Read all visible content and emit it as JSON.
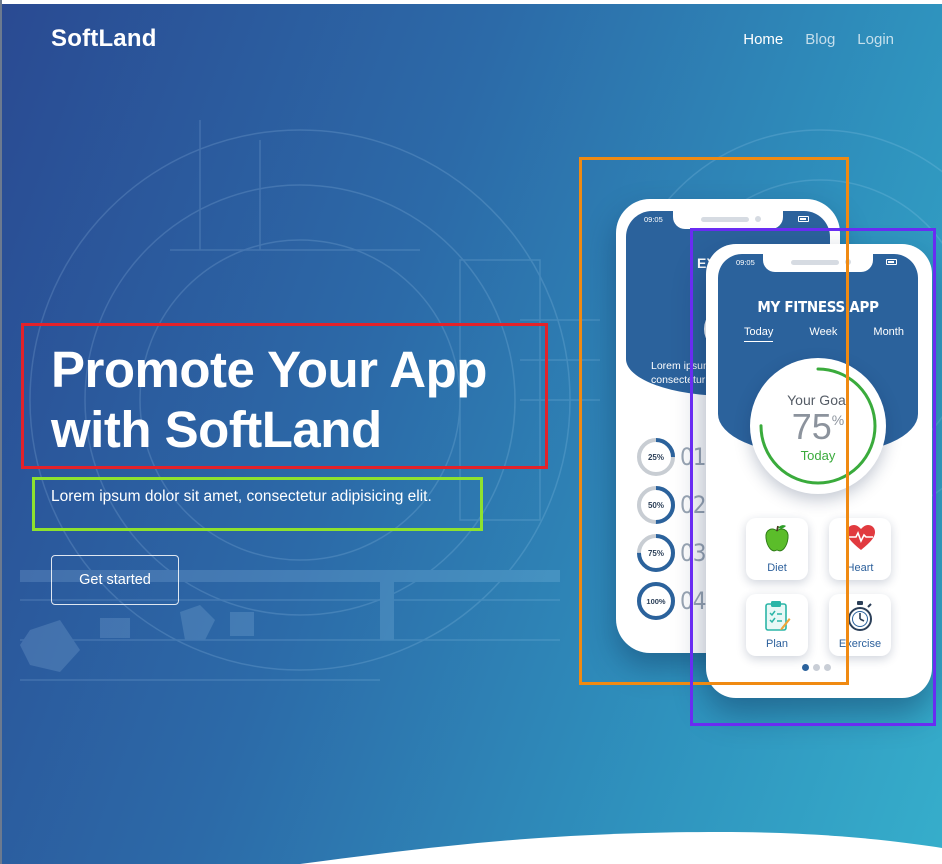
{
  "brand": "SoftLand",
  "nav": [
    {
      "label": "Home",
      "active": true
    },
    {
      "label": "Blog",
      "active": false
    },
    {
      "label": "Login",
      "active": false
    }
  ],
  "hero": {
    "headline_line1": "Promote Your App",
    "headline_line2": "with SoftLand",
    "subtitle": "Lorem ipsum dolor sit amet, consectetur adipisicing elit.",
    "cta_label": "Get started"
  },
  "phone_back": {
    "time": "09:05",
    "title": "EXE",
    "lorem_line1": "Lorem ipsum",
    "lorem_line2": "consectetur",
    "progress": [
      {
        "percent_label": "25%",
        "value": 25,
        "number": "01"
      },
      {
        "percent_label": "50%",
        "value": 50,
        "number": "02"
      },
      {
        "percent_label": "75%",
        "value": 75,
        "number": "03"
      },
      {
        "percent_label": "100%",
        "value": 100,
        "number": "04"
      }
    ]
  },
  "phone_front": {
    "time": "09:05",
    "title": "MY FITNESS APP",
    "tabs": [
      {
        "label": "Today",
        "active": true
      },
      {
        "label": "Week",
        "active": false
      },
      {
        "label": "Month",
        "active": false
      }
    ],
    "goal": {
      "label": "Your Goal",
      "value": "75",
      "unit": "%",
      "period": "Today",
      "fraction": 0.75
    },
    "tiles": [
      {
        "label": "Diet",
        "icon": "apple-icon"
      },
      {
        "label": "Heart",
        "icon": "heart-icon"
      },
      {
        "label": "Plan",
        "icon": "clipboard-icon"
      },
      {
        "label": "Exercise",
        "icon": "stopwatch-icon"
      }
    ],
    "carousel": {
      "total": 3,
      "active": 1
    }
  },
  "colors": {
    "gradient_start": "#2a4a92",
    "gradient_end": "#36aecb",
    "phone_header": "#2b629c",
    "goal_green": "#3aab3c",
    "annotation_red": "#e3222a",
    "annotation_green": "#8ee22e",
    "annotation_orange": "#f08a12",
    "annotation_purple": "#6a2cf2"
  }
}
